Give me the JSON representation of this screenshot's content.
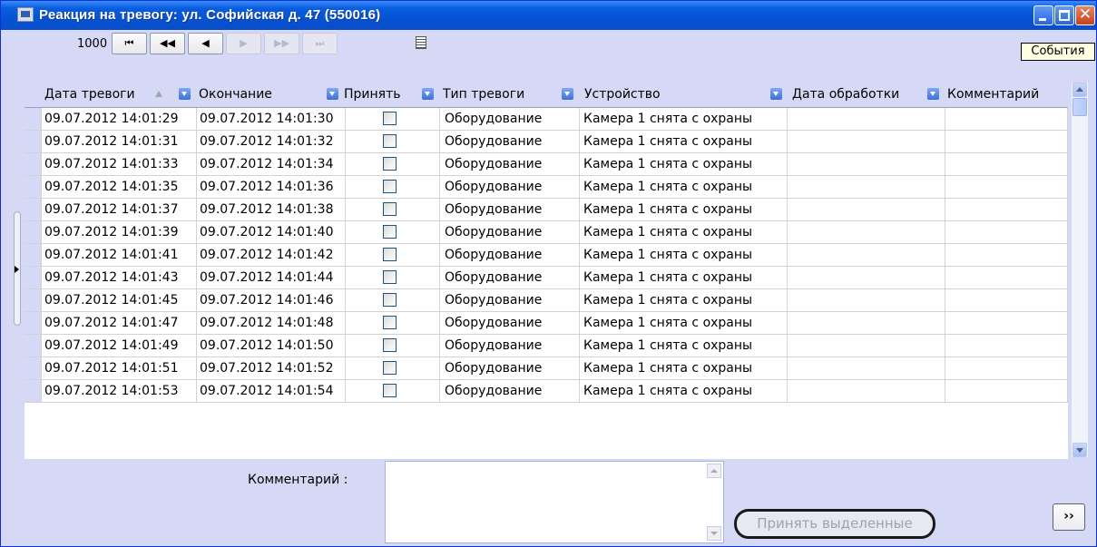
{
  "window": {
    "title": "Реакция на тревогу: ул. Софийская д. 47 (550016)",
    "close_glyph": "✕"
  },
  "toolbar": {
    "record_count": "1000",
    "nav_first": "⏮",
    "nav_prev_page": "◀◀",
    "nav_prev": "◀",
    "nav_next": "▶",
    "nav_next_page": "▶▶",
    "nav_last": "⏭",
    "events_tooltip": "События"
  },
  "table": {
    "columns": [
      "Дата тревоги",
      "Окончание",
      "Принять",
      "Тип тревоги",
      "Устройство",
      "Дата обработки",
      "Комментарий"
    ],
    "rows": [
      {
        "alarm_date": "09.07.2012 14:01:29",
        "end": "09.07.2012 14:01:30",
        "accepted": false,
        "type": "Оборудование",
        "device": "Камера 1 снята с охраны",
        "processed": "",
        "comment": ""
      },
      {
        "alarm_date": "09.07.2012 14:01:31",
        "end": "09.07.2012 14:01:32",
        "accepted": false,
        "type": "Оборудование",
        "device": "Камера 1 снята с охраны",
        "processed": "",
        "comment": ""
      },
      {
        "alarm_date": "09.07.2012 14:01:33",
        "end": "09.07.2012 14:01:34",
        "accepted": false,
        "type": "Оборудование",
        "device": "Камера 1 снята с охраны",
        "processed": "",
        "comment": ""
      },
      {
        "alarm_date": "09.07.2012 14:01:35",
        "end": "09.07.2012 14:01:36",
        "accepted": false,
        "type": "Оборудование",
        "device": "Камера 1 снята с охраны",
        "processed": "",
        "comment": ""
      },
      {
        "alarm_date": "09.07.2012 14:01:37",
        "end": "09.07.2012 14:01:38",
        "accepted": false,
        "type": "Оборудование",
        "device": "Камера 1 снята с охраны",
        "processed": "",
        "comment": ""
      },
      {
        "alarm_date": "09.07.2012 14:01:39",
        "end": "09.07.2012 14:01:40",
        "accepted": false,
        "type": "Оборудование",
        "device": "Камера 1 снята с охраны",
        "processed": "",
        "comment": ""
      },
      {
        "alarm_date": "09.07.2012 14:01:41",
        "end": "09.07.2012 14:01:42",
        "accepted": false,
        "type": "Оборудование",
        "device": "Камера 1 снята с охраны",
        "processed": "",
        "comment": ""
      },
      {
        "alarm_date": "09.07.2012 14:01:43",
        "end": "09.07.2012 14:01:44",
        "accepted": false,
        "type": "Оборудование",
        "device": "Камера 1 снята с охраны",
        "processed": "",
        "comment": ""
      },
      {
        "alarm_date": "09.07.2012 14:01:45",
        "end": "09.07.2012 14:01:46",
        "accepted": false,
        "type": "Оборудование",
        "device": "Камера 1 снята с охраны",
        "processed": "",
        "comment": ""
      },
      {
        "alarm_date": "09.07.2012 14:01:47",
        "end": "09.07.2012 14:01:48",
        "accepted": false,
        "type": "Оборудование",
        "device": "Камера 1 снята с охраны",
        "processed": "",
        "comment": ""
      },
      {
        "alarm_date": "09.07.2012 14:01:49",
        "end": "09.07.2012 14:01:50",
        "accepted": false,
        "type": "Оборудование",
        "device": "Камера 1 снята с охраны",
        "processed": "",
        "comment": ""
      },
      {
        "alarm_date": "09.07.2012 14:01:51",
        "end": "09.07.2012 14:01:52",
        "accepted": false,
        "type": "Оборудование",
        "device": "Камера 1 снята с охраны",
        "processed": "",
        "comment": ""
      },
      {
        "alarm_date": "09.07.2012 14:01:53",
        "end": "09.07.2012 14:01:54",
        "accepted": false,
        "type": "Оборудование",
        "device": "Камера 1 снята с охраны",
        "processed": "",
        "comment": ""
      }
    ]
  },
  "footer": {
    "comment_label": "Комментарий :",
    "comment_value": "",
    "accept_selected_label": "Принять выделенные",
    "more_label": "››"
  }
}
